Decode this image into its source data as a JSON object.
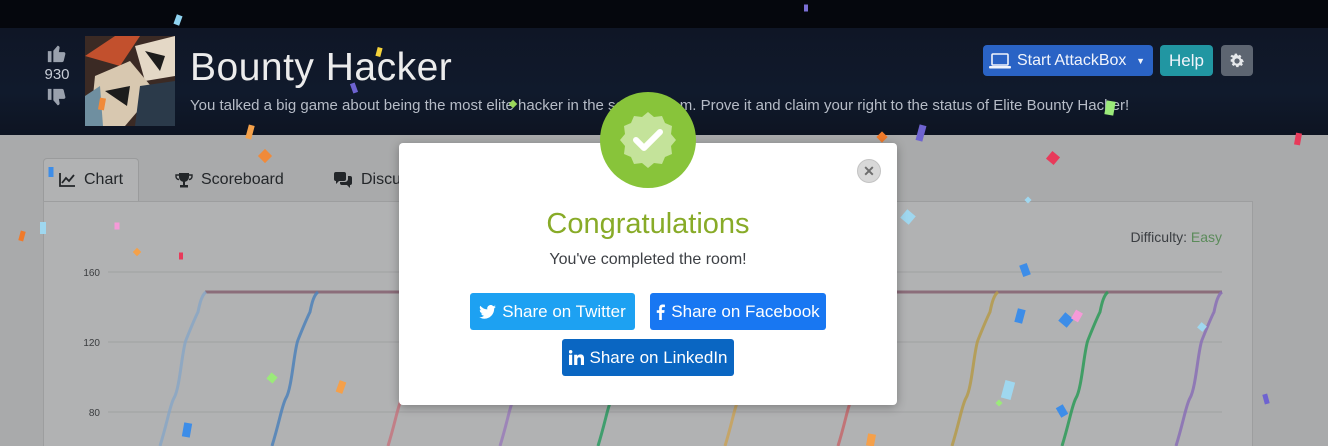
{
  "room": {
    "title": "Bounty Hacker",
    "description": "You talked a big game about being the most elite hacker in the solar system. Prove it and claim your right to the status of Elite Bounty Hacker!",
    "votes": "930"
  },
  "header_buttons": {
    "attackbox": "Start AttackBox",
    "help": "Help"
  },
  "tabs": [
    {
      "label": "Chart",
      "icon": "chart-line-icon"
    },
    {
      "label": "Scoreboard",
      "icon": "trophy-icon"
    },
    {
      "label": "Discussion",
      "icon": "comments-icon"
    }
  ],
  "difficulty": {
    "label": "Difficulty:",
    "value": "Easy"
  },
  "chart_data": {
    "type": "line",
    "y_ticks": [
      "160",
      "120",
      "80"
    ],
    "series_colors": [
      "#8aa6c4",
      "#4f81b8",
      "#c4757f",
      "#9a7cb8",
      "#2d9a61",
      "#c9a25a",
      "#c4686c",
      "#b59a4a",
      "#2e9a58",
      "#8a6fb5"
    ]
  },
  "modal": {
    "title": "Congratulations",
    "message": "You've completed the room!",
    "twitter": "Share on Twitter",
    "facebook": "Share on Facebook",
    "linkedin": "Share on LinkedIn"
  },
  "colors": {
    "success": "#88c43a",
    "title": "#88ab28",
    "twitter": "#1da1f2",
    "facebook": "#1877f2",
    "linkedin": "#0a66c2"
  }
}
